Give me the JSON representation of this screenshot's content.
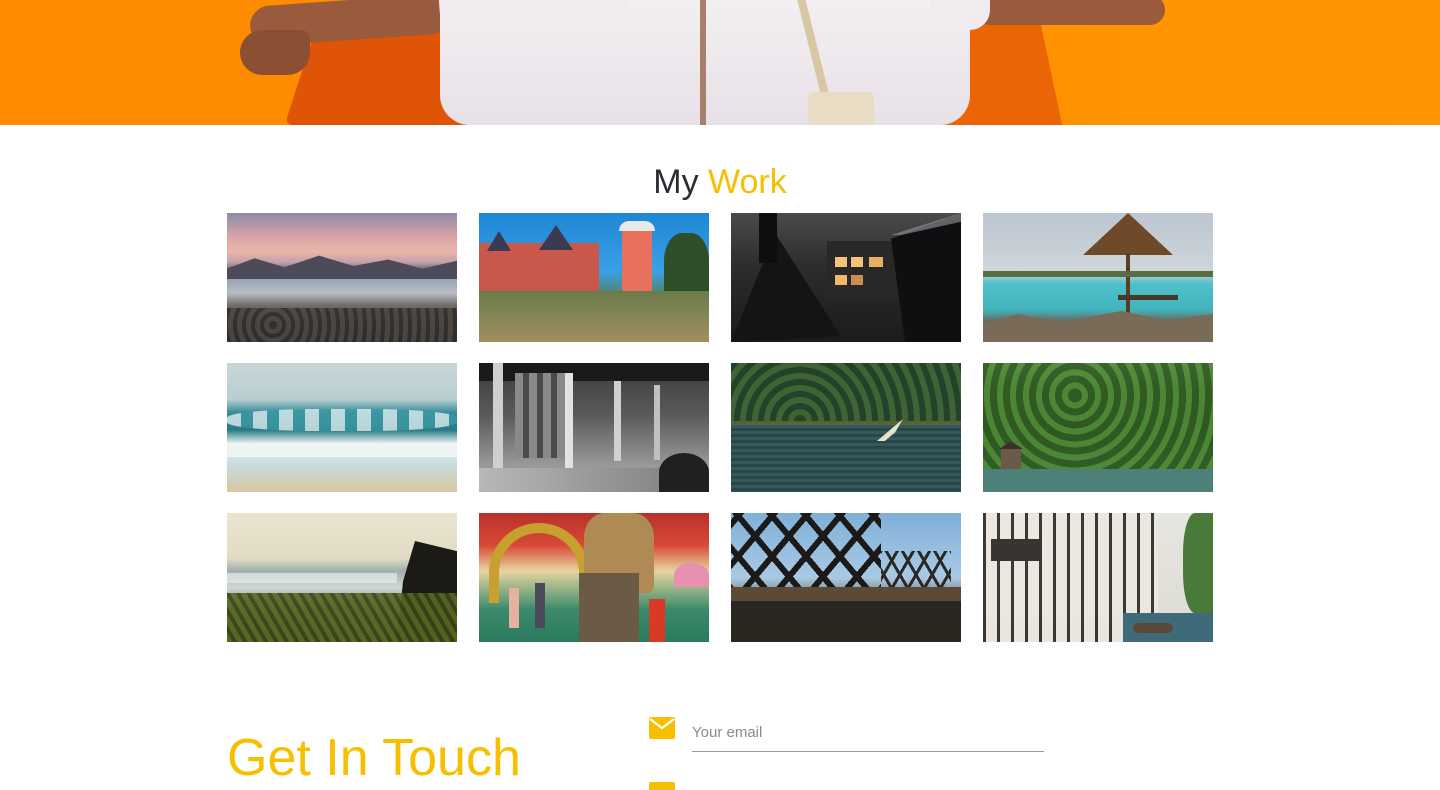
{
  "section": {
    "title_part1": "My",
    "title_part2": "Work"
  },
  "gallery": {
    "items": [
      {
        "subject": "beach at sunset with mountains"
      },
      {
        "subject": "red brick castle with lighthouse tower"
      },
      {
        "subject": "house at night with lit windows"
      },
      {
        "subject": "thatched umbrella over turquoise sea"
      },
      {
        "subject": "ocean waves on sandy shore"
      },
      {
        "subject": "black and white building colonnade"
      },
      {
        "subject": "bird flying over lake with forest"
      },
      {
        "subject": "boathouse beneath green forest"
      },
      {
        "subject": "waves behind coastal rocks and grass"
      },
      {
        "subject": "people at ornate temple gate"
      },
      {
        "subject": "steel truss railway bridge"
      },
      {
        "subject": "tudor timber-framed buildings by canal"
      }
    ]
  },
  "contact": {
    "title": "Get In Touch",
    "email_placeholder": "Your email"
  },
  "colors": {
    "accent": "#f6c000",
    "heading_dark": "#2c2c33",
    "hero_orange": "#ff8f00"
  },
  "icons": {
    "email_field": "mail-icon",
    "second_field": "message-icon"
  }
}
